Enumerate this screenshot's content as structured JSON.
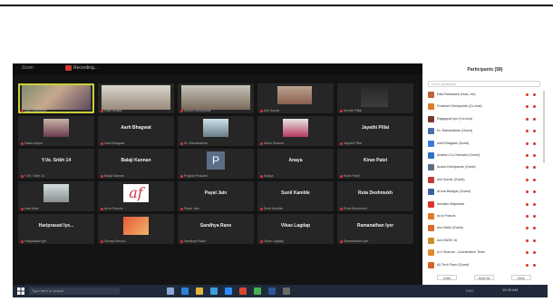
{
  "window": {
    "title": "Zoom",
    "rec_label": "Recording..."
  },
  "tiles": [
    {
      "name": "",
      "footer": "Kala Rathanam",
      "kind": "vid-a",
      "active": true
    },
    {
      "name": "",
      "footer": "Rajiv Bhatia",
      "kind": "vid-b"
    },
    {
      "name": "",
      "footer": "Anand Deshpande",
      "kind": "vid-c"
    },
    {
      "name": "",
      "footer": "Anil Kumar",
      "kind": "vid-d"
    },
    {
      "name": "",
      "footer": "Suresh Pillai",
      "kind": "vid-e"
    },
    {
      "name": "",
      "footer": "Nazia Anjum",
      "kind": "ph1"
    },
    {
      "name": "Aarti Bhagwat",
      "footer": "Aarti Bhagwat"
    },
    {
      "name": "",
      "footer": "Dr. Ramanathan",
      "kind": "ph2"
    },
    {
      "name": "",
      "footer": "Neha Sharma",
      "kind": "ph3"
    },
    {
      "name": "Jayathi Pillai",
      "footer": "Jayathi Pillai"
    },
    {
      "name": "Y.Ve. Srikh 14",
      "footer": "Y.Ve. Srikh 14"
    },
    {
      "name": "Balaji Kannan",
      "footer": "Balaji Kannan"
    },
    {
      "name": "",
      "footer": "Prajwal Prakash",
      "kind": "initial",
      "initial": "P"
    },
    {
      "name": "Anaya",
      "footer": "Anaya"
    },
    {
      "name": "Kiran Patel",
      "footer": "Kiran Patel"
    },
    {
      "name": "",
      "footer": "Lata Mani",
      "kind": "ph4"
    },
    {
      "name": "",
      "footer": "Arun Francis",
      "kind": "ph5",
      "glyph": "af"
    },
    {
      "name": "Payal Jain",
      "footer": "Payal Jain"
    },
    {
      "name": "Sunil Kamble",
      "footer": "Sunil Kamble"
    },
    {
      "name": "Ruta Deshmukh",
      "footer": "Ruta Deshmukh"
    },
    {
      "name": "Hariprasad Iye...",
      "footer": "Hariprasad Iyer"
    },
    {
      "name": "",
      "footer": "Shreya Menon",
      "kind": "ph6"
    },
    {
      "name": "Sandhya Rane",
      "footer": "Sandhya Rane"
    },
    {
      "name": "Vikas Lagdap",
      "footer": "Vikas Lagdap"
    },
    {
      "name": "Ramanathan Iyer",
      "footer": "Ramanathan Iyer"
    }
  ],
  "panel": {
    "title": "Participants (58)",
    "search_placeholder": "Find a participant",
    "participants": [
      {
        "name": "Kala Rathanam (Host, me)",
        "color": "#c0623a"
      },
      {
        "name": "Prashant Deshpande (Co-host)",
        "color": "#e07b2a"
      },
      {
        "name": "Rajagopal Iyer (Co-host)",
        "color": "#7a3b2e"
      },
      {
        "name": "Dr. Ramanathan (Guest)",
        "color": "#4a6ea8"
      },
      {
        "name": "Aarti Bhagwat (Guest)",
        "color": "#3b7dd8"
      },
      {
        "name": "Andheri Co-Ordinator (Guest)",
        "color": "#2f6fc8"
      },
      {
        "name": "Anand Deshpande (Guest)",
        "color": "#5a6e86"
      },
      {
        "name": "Anil Kumar (Guest)",
        "color": "#c23b3b"
      },
      {
        "name": "Aruna Bhargav (Guest)",
        "color": "#3e62a8"
      },
      {
        "name": "Arindam Majumdar",
        "color": "#d8352e"
      },
      {
        "name": "Arun Francis",
        "color": "#e07b2a"
      },
      {
        "name": "Anu Malik (Guest)",
        "color": "#d86a2a"
      },
      {
        "name": "Anu BASE 16",
        "color": "#c9902a"
      },
      {
        "name": "A.H Sharma - Coordination Team",
        "color": "#e08a2a"
      },
      {
        "name": "AV.Tech Team (Guest)",
        "color": "#d8602a"
      }
    ],
    "invite_label": "Invite",
    "mute_all_label": "Mute All",
    "more_label": "More"
  },
  "taskbar": {
    "search_placeholder": "Type here to search",
    "time": "10:25 AM",
    "sys": "ENG"
  },
  "colors": {
    "active_border": "#c9cf3a",
    "mic_muted": "#d8352e",
    "panel_bg": "#ffffff",
    "meeting_bg": "#141414"
  }
}
